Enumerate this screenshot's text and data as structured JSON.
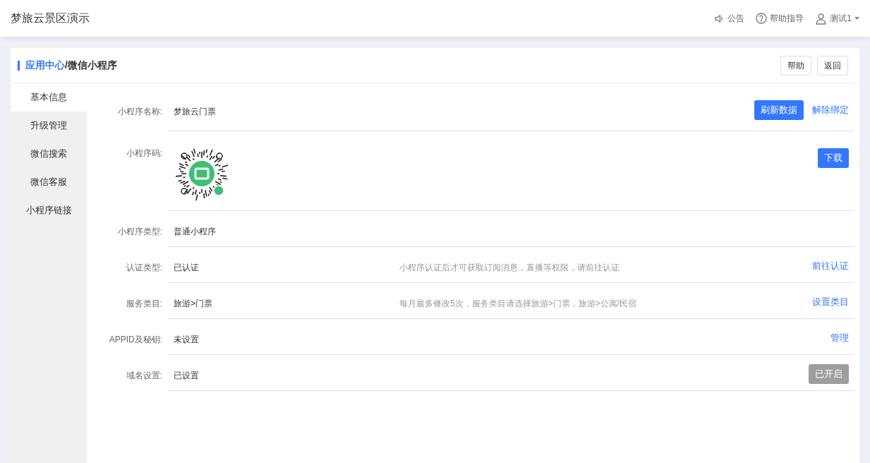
{
  "header": {
    "title": "梦旅云景区演示",
    "announcement": "公告",
    "help": "帮助指导",
    "user": "测试1"
  },
  "breadcrumb": {
    "parent": "应用中心",
    "separator": "/",
    "current": "微信小程序"
  },
  "card_buttons": [
    "帮助",
    "返回"
  ],
  "sidebar": {
    "items": [
      {
        "label": "基本信息",
        "selected": true
      },
      {
        "label": "升级管理",
        "selected": false
      },
      {
        "label": "微信搜索",
        "selected": false
      },
      {
        "label": "微信客服",
        "selected": false
      },
      {
        "label": "小程序链接",
        "selected": false
      }
    ]
  },
  "rows": [
    {
      "kind": "text",
      "label": "小程序名称:",
      "value": "梦旅云门票",
      "actions": [
        {
          "kind": "primary",
          "label": "刷新数据"
        },
        {
          "kind": "link",
          "label": "解除绑定"
        }
      ]
    },
    {
      "kind": "qr",
      "label": "小程序码:",
      "actions": [
        {
          "kind": "primary",
          "label": "下载"
        }
      ]
    },
    {
      "kind": "text",
      "label": "小程序类型:",
      "value": "普通小程序"
    },
    {
      "kind": "text",
      "label": "认证类型:",
      "value": "已认证",
      "note": "小程序认证后才可获取订阅消息，直播等权限，请前往认证",
      "actions": [
        {
          "kind": "link",
          "label": "前往认证"
        }
      ]
    },
    {
      "kind": "text",
      "label": "服务类目:",
      "value": "旅游>门票",
      "note": "每月最多修改5次，服务类目请选择旅游>门票，旅游>公寓/民宿",
      "actions": [
        {
          "kind": "link",
          "label": "设置类目"
        }
      ]
    },
    {
      "kind": "text",
      "label": "APPID及秘钥:",
      "value": "未设置",
      "actions": [
        {
          "kind": "link",
          "label": "管理"
        }
      ]
    },
    {
      "kind": "text",
      "label": "域名设置:",
      "value": "已设置",
      "actions": [
        {
          "kind": "disabled",
          "label": "已开启"
        }
      ]
    }
  ]
}
